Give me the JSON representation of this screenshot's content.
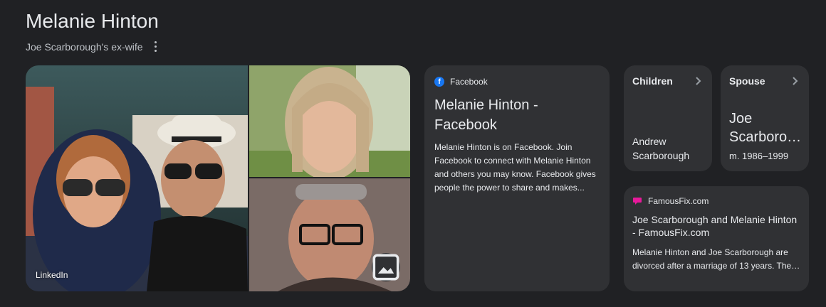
{
  "header": {
    "title": "Melanie Hinton",
    "subtitle": "Joe Scarborough's ex-wife"
  },
  "photos": {
    "main_source_label": "LinkedIn",
    "image_button_icon": "image-icon"
  },
  "facebook_card": {
    "source": "Facebook",
    "title": "Melanie Hinton - Facebook",
    "snippet": "Melanie Hinton is on Facebook. Join Facebook to connect with Melanie Hinton and others you may know. Facebook gives people the power to share and makes...",
    "icon": "facebook-icon"
  },
  "children_card": {
    "heading": "Children",
    "name_line1": "Andrew",
    "name_line2": "Scarborough",
    "icon": "chevron-right-icon"
  },
  "spouse_card": {
    "heading": "Spouse",
    "name_line1": "Joe",
    "name_line2": "Scarboro…",
    "years": "m. 1986–1999",
    "icon": "chevron-right-icon"
  },
  "famousfix_card": {
    "source": "FamousFix.com",
    "title": "Joe Scarborough and Melanie Hinton - FamousFix.com",
    "snippet": "Melanie Hinton and Joe Scarborough are divorced after a marriage of 13 years. The…",
    "icon": "famousfix-icon"
  },
  "colors": {
    "background": "#202124",
    "card": "#303134",
    "text": "#e8eaed",
    "muted_text": "#bdc1c6",
    "facebook_blue": "#1877f2",
    "famousfix_pink": "#e8199b"
  }
}
